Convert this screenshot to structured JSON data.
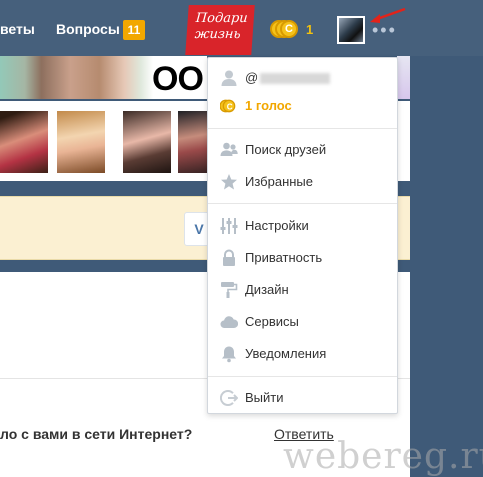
{
  "header": {
    "nav_answers": "веты",
    "nav_questions": "Вопросы",
    "questions_badge": "11",
    "promo_line1": "Подари",
    "promo_line2": "жизнь",
    "coins_count": "1",
    "more_dots": "•••"
  },
  "banner": {
    "text": "OO"
  },
  "vk_button": {
    "label": "V"
  },
  "dropdown": {
    "username_prefix": "@",
    "votes_label": "1 голос",
    "items": [
      {
        "label": "Поиск друзей",
        "icon": "find-friends-icon"
      },
      {
        "label": "Избранные",
        "icon": "star-icon"
      },
      {
        "label": "Настройки",
        "icon": "settings-sliders-icon"
      },
      {
        "label": "Приватность",
        "icon": "lock-icon"
      },
      {
        "label": "Дизайн",
        "icon": "paint-roller-icon"
      },
      {
        "label": "Сервисы",
        "icon": "cloud-icon"
      },
      {
        "label": "Уведомления",
        "icon": "bell-icon"
      },
      {
        "label": "Выйти",
        "icon": "logout-icon"
      }
    ]
  },
  "feed": {
    "question_text": "ло с вами в сети Интернет?",
    "answer_link": "Ответить"
  },
  "watermark": "webereg.ru",
  "colors": {
    "topbar": "#46607c",
    "accent_orange": "#f2a700",
    "promo_red": "#d9242a",
    "icon_gray": "#b6bfc8"
  }
}
